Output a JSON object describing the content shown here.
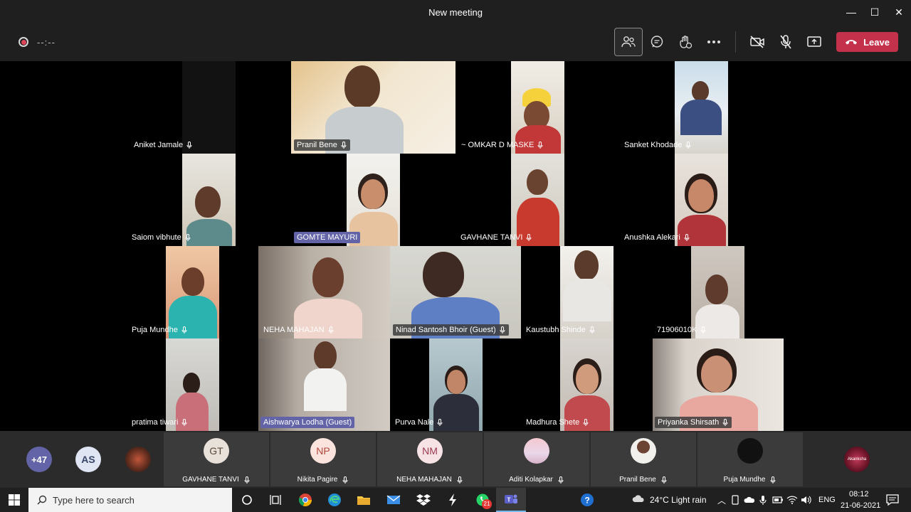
{
  "window": {
    "title": "New meeting",
    "minimize": "—",
    "maximize": "☐",
    "close": "✕"
  },
  "toolbar": {
    "timer": "--:--",
    "leave_label": "Leave"
  },
  "tiles": [
    {
      "name": "Aniket Jamale",
      "style": "plain"
    },
    {
      "name": "Pranil Bene",
      "style": "boxed"
    },
    {
      "name": "~ OMKAR D MASKE",
      "style": "plain"
    },
    {
      "name": "Sanket Khodade",
      "style": "plain"
    },
    {
      "name": "Saiom vibhute",
      "style": "plain"
    },
    {
      "name": "GOMTE MAYURI",
      "style": "spotlit"
    },
    {
      "name": "GAVHANE TANVI",
      "style": "plain"
    },
    {
      "name": "Anushka Alekari",
      "style": "plain"
    },
    {
      "name": "Puja Mundhe",
      "style": "plain"
    },
    {
      "name": "NEHA MAHAJAN",
      "style": "plain"
    },
    {
      "name": "Ninad Santosh Bhoir (Guest)",
      "style": "boxed"
    },
    {
      "name": "Kaustubh Shinde",
      "style": "plain"
    },
    {
      "name": "71906010K",
      "style": "plain"
    },
    {
      "name": "pratima tiwari",
      "style": "plain"
    },
    {
      "name": "Aishwarya Lodha (Guest)",
      "style": "spotlit"
    },
    {
      "name": "Purva Nale",
      "style": "plain"
    },
    {
      "name": "Madhura  Shete",
      "style": "plain"
    },
    {
      "name": "Priyanka Shirsath",
      "style": "boxed"
    }
  ],
  "strip": {
    "overflow_count": "+47",
    "as_initials": "AS",
    "tiles": [
      {
        "initials": "GT",
        "name": "GAVHANE TANVI"
      },
      {
        "initials": "NP",
        "name": "Nikita Pagire"
      },
      {
        "initials": "NM",
        "name": "NEHA MAHAJAN"
      },
      {
        "initials": "",
        "name": "Aditi Kolapkar"
      },
      {
        "initials": "",
        "name": "Pranil Bene"
      },
      {
        "initials": "",
        "name": "Puja Mundhe"
      }
    ],
    "last_avatar_text": "Akanksha"
  },
  "taskbar": {
    "search_placeholder": "Type here to search",
    "whatsapp_badge": "21",
    "weather": "24°C  Light rain",
    "lang": "ENG",
    "time": "08:12",
    "date": "21-06-2021"
  }
}
